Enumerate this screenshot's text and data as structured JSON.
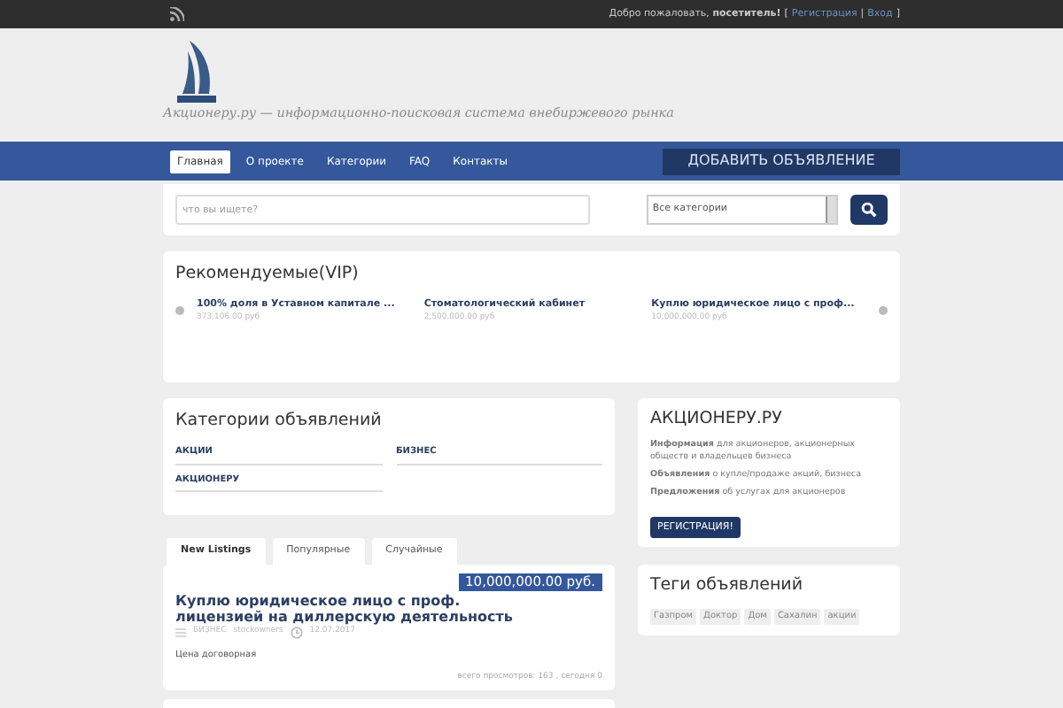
{
  "topbar": {
    "greeting": "Добро пожаловать, **посетитель!**",
    "open": "[",
    "separator": "|",
    "close": "]",
    "links": [
      {
        "label": "Регистрация"
      },
      {
        "label": "Вход"
      }
    ]
  },
  "header": {
    "tagline": "Акционеру.ру — информационно-поисковая система внебиржевого рынка"
  },
  "nav": {
    "items": [
      {
        "label": "Главная",
        "selected": true
      },
      {
        "label": "О проекте",
        "selected": false
      },
      {
        "label": "Категории",
        "selected": false
      },
      {
        "label": "FAQ",
        "selected": false
      },
      {
        "label": "Контакты",
        "selected": false
      }
    ],
    "cta": "ДОБАВИТЬ ОБЪЯВЛЕНИЕ"
  },
  "search": {
    "placeholder": "что вы ищете?",
    "category": "Все категории"
  },
  "vip": {
    "title": "Рекомендуемые(VIP)",
    "items": [
      {
        "title": "100% доля в Уставном капитале ...",
        "price": "373,106.00 руб"
      },
      {
        "title": "Стоматологический кабинет",
        "price": "2,500,000.00 руб"
      },
      {
        "title": "Куплю юридическое лицо с проф...",
        "price": "10,000,000.00 руб"
      }
    ]
  },
  "categories": {
    "title": "Категории объявлений",
    "items": [
      "АКЦИИ",
      "БИЗНЕС",
      "АКЦИОНЕРУ"
    ]
  },
  "tabs": [
    {
      "label": "New Listings",
      "selected": true
    },
    {
      "label": "Популярные",
      "selected": false
    },
    {
      "label": "Случайные",
      "selected": false
    }
  ],
  "listing": {
    "price": "10,000,000.00 руб.",
    "title": "Куплю юридическое лицо с проф. лицензией на диллерскую деятельность",
    "category": "БИЗНЕС",
    "author": "stockowners",
    "date": "12.07.2017",
    "description": "Цена договорная",
    "views": "всего просмотров: 163 , сегодня 0"
  },
  "about": {
    "title": "АКЦИОНЕРУ.РУ",
    "lines": [
      "**Информация** для акционеров, акционерных обществ и владельцев бизнеса",
      "**Объявления** о купле/продаже акций, бизнеса",
      "**Предложения** об услугах для акционеров"
    ],
    "button": "РЕГИСТРАЦИЯ!"
  },
  "tags": {
    "title": "Теги объявлений",
    "items": [
      "Газпром",
      "Доктор",
      "Дом",
      "Сахалин",
      "акции"
    ]
  }
}
